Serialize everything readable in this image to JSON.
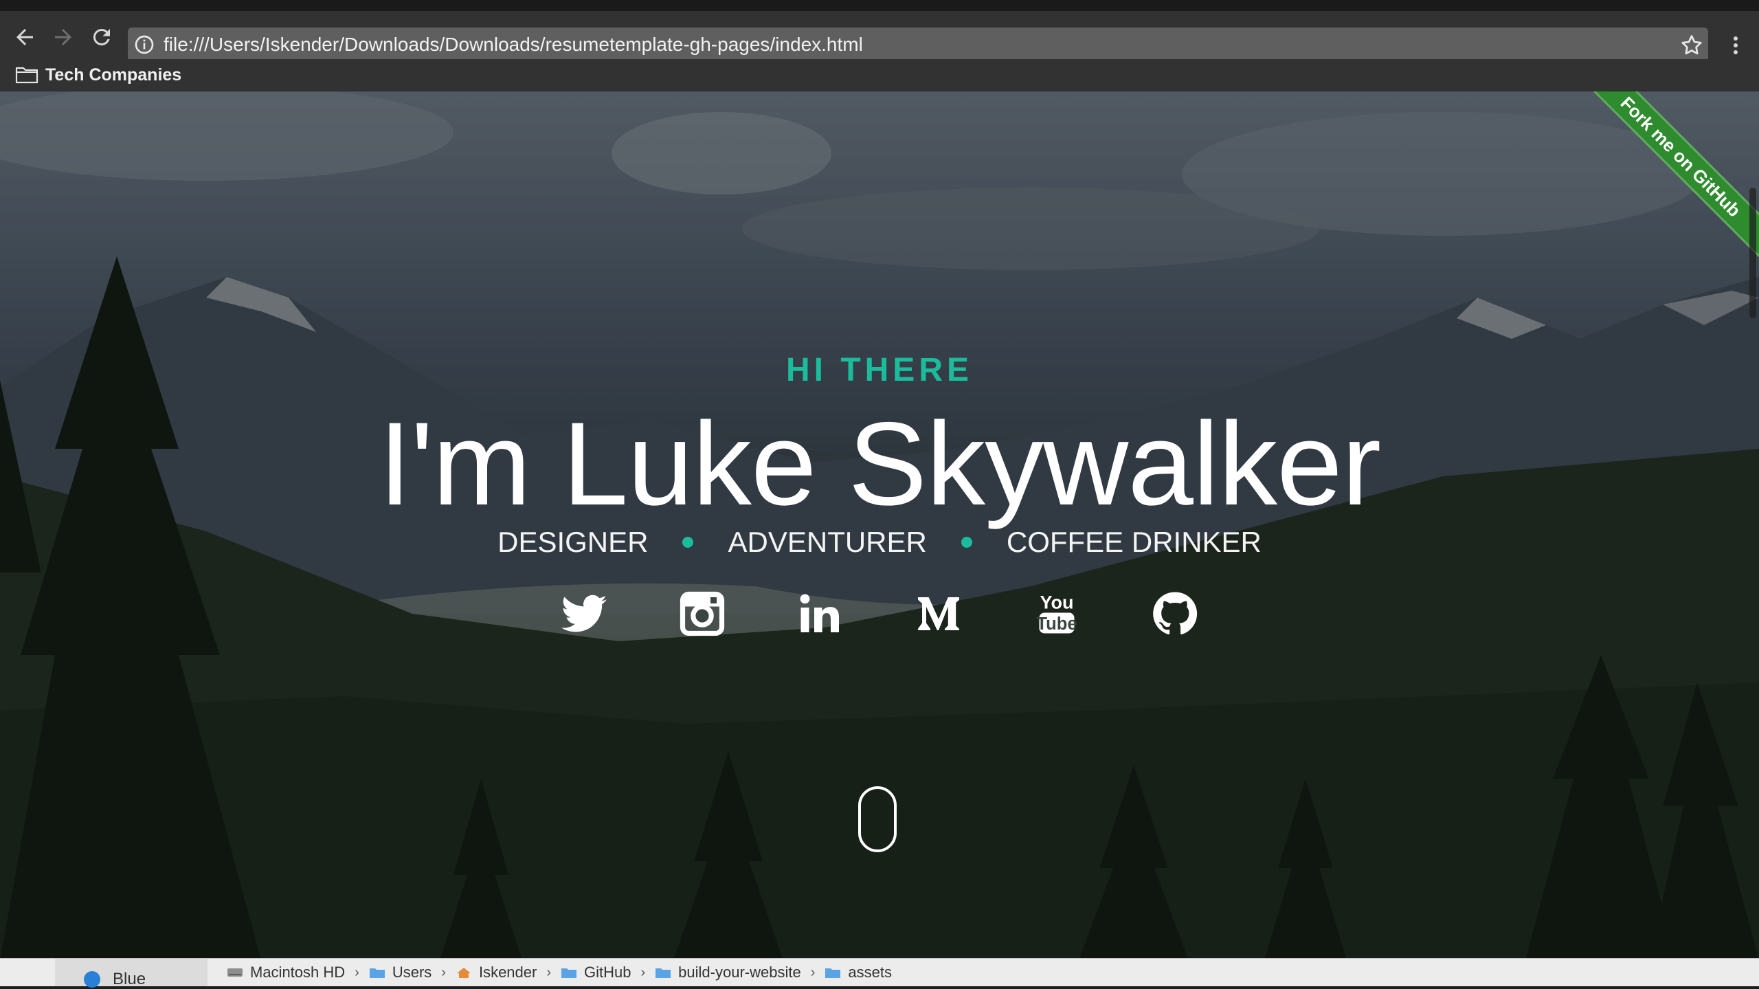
{
  "browser": {
    "url": "file:///Users/Iskender/Downloads/Downloads/resumetemplate-gh-pages/index.html",
    "bookmarks": [
      {
        "label": "Tech Companies",
        "icon": "folder-icon"
      }
    ]
  },
  "hero": {
    "greeting": "HI THERE",
    "headline": "I'm Luke Skywalker",
    "roles": [
      "DESIGNER",
      "ADVENTURER",
      "COFFEE DRINKER"
    ],
    "accent_color": "#1abc9c",
    "social": [
      {
        "name": "twitter-icon"
      },
      {
        "name": "instagram-icon"
      },
      {
        "name": "linkedin-icon"
      },
      {
        "name": "medium-icon"
      },
      {
        "name": "youtube-icon"
      },
      {
        "name": "github-icon"
      }
    ],
    "ribbon": "Fork me on GitHub",
    "ribbon_color": "#2e8b2e"
  },
  "finder": {
    "sidebar_tag": "Blue",
    "path": [
      "Macintosh HD",
      "Users",
      "Iskender",
      "GitHub",
      "build-your-website",
      "assets"
    ]
  }
}
